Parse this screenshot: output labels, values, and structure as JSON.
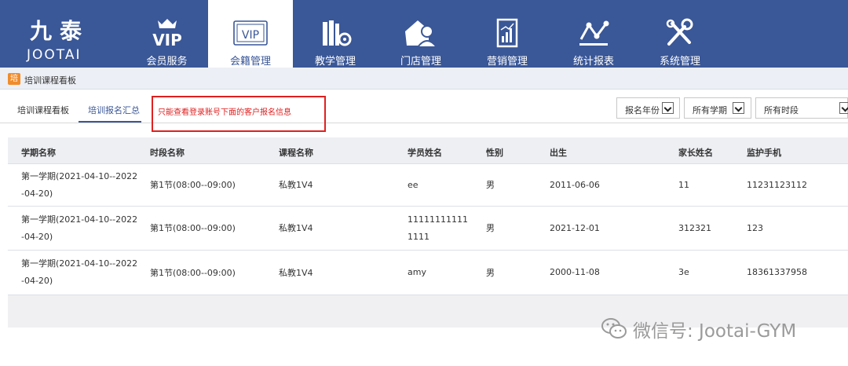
{
  "brand": {
    "cn": "九泰",
    "en": "JOOTAI"
  },
  "nav": [
    {
      "label": "会员服务",
      "icon": "vip-icon"
    },
    {
      "label": "会籍管理",
      "icon": "vip-card-icon"
    },
    {
      "label": "教学管理",
      "icon": "books-gear-icon"
    },
    {
      "label": "门店管理",
      "icon": "store-user-icon"
    },
    {
      "label": "营销管理",
      "icon": "chart-doc-icon"
    },
    {
      "label": "统计报表",
      "icon": "stats-icon"
    },
    {
      "label": "系统管理",
      "icon": "tools-icon"
    }
  ],
  "vip_text": "VIP",
  "vip_card_text": "VIP",
  "subbar": {
    "icon_text": "培",
    "title": "培训课程看板"
  },
  "tabs": [
    {
      "label": "培训课程看板"
    },
    {
      "label": "培训报名汇总"
    }
  ],
  "notice": "只能查看登录账号下面的客户报名信息",
  "filters": {
    "year": "报名年份",
    "term": "所有学期",
    "period": "所有时段"
  },
  "table": {
    "headers": [
      "学期名称",
      "时段名称",
      "课程名称",
      "学员姓名",
      "性别",
      "出生",
      "家长姓名",
      "监护手机"
    ],
    "rows": [
      {
        "term1": "第一学期(2021-04-10--2022",
        "term2": "-04-20)",
        "period": "第1节(08:00--09:00)",
        "course": "私教1V4",
        "student1": "ee",
        "student2": "",
        "gender": "男",
        "birth": "2011-06-06",
        "parent": "11",
        "phone": "11231123112"
      },
      {
        "term1": "第一学期(2021-04-10--2022",
        "term2": "-04-20)",
        "period": "第1节(08:00--09:00)",
        "course": "私教1V4",
        "student1": "11111111111",
        "student2": "1111",
        "gender": "男",
        "birth": "2021-12-01",
        "parent": "312321",
        "phone": "123"
      },
      {
        "term1": "第一学期(2021-04-10--2022",
        "term2": "-04-20)",
        "period": "第1节(08:00--09:00)",
        "course": "私教1V4",
        "student1": "amy",
        "student2": "",
        "gender": "男",
        "birth": "2000-11-08",
        "parent": "3e",
        "phone": "18361337958"
      }
    ]
  },
  "watermark": "微信号: Jootai-GYM",
  "colors": {
    "nav_bg": "#3a5797",
    "notice_red": "#e02020",
    "accent": "#f08c2b"
  }
}
